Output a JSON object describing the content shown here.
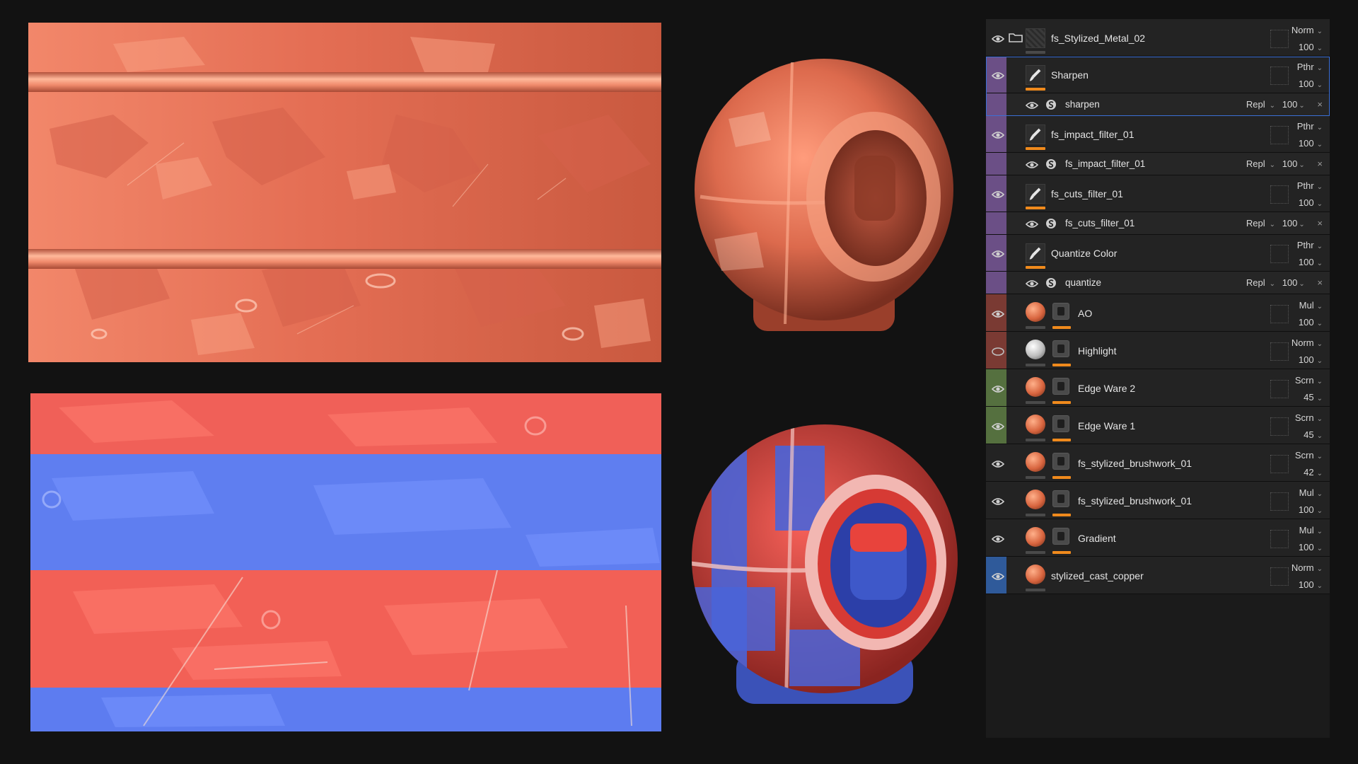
{
  "layers": [
    {
      "name": "fs_Stylized_Metal_02",
      "blend": "Norm",
      "opacity": "100",
      "type": "folder",
      "strip": "",
      "thumb": "folder"
    },
    {
      "name": "Sharpen",
      "blend": "Pthr",
      "opacity": "100",
      "type": "filter",
      "strip": "#6b4f86",
      "sub": {
        "name": "sharpen",
        "blend": "Repl",
        "opacity": "100"
      }
    },
    {
      "name": "fs_impact_filter_01",
      "blend": "Pthr",
      "opacity": "100",
      "type": "filter",
      "strip": "#6b4f86",
      "sub": {
        "name": "fs_impact_filter_01",
        "blend": "Repl",
        "opacity": "100"
      }
    },
    {
      "name": "fs_cuts_filter_01",
      "blend": "Pthr",
      "opacity": "100",
      "type": "filter",
      "strip": "#6b4f86",
      "sub": {
        "name": "fs_cuts_filter_01",
        "blend": "Repl",
        "opacity": "100"
      }
    },
    {
      "name": "Quantize Color",
      "blend": "Pthr",
      "opacity": "100",
      "type": "filter",
      "strip": "#6b4f86",
      "sub": {
        "name": "quantize",
        "blend": "Repl",
        "opacity": "100"
      }
    },
    {
      "name": "AO",
      "blend": "Mul",
      "opacity": "100",
      "type": "fill",
      "strip": "#7a3a33",
      "sphere": "copper"
    },
    {
      "name": "Highlight",
      "blend": "Norm",
      "opacity": "100",
      "type": "fill",
      "strip": "#7a3a33",
      "sphere": "white",
      "eye": "hidden"
    },
    {
      "name": "Edge Ware 2",
      "blend": "Scrn",
      "opacity": "45",
      "type": "fill",
      "strip": "#55703f",
      "sphere": "copper"
    },
    {
      "name": "Edge Ware 1",
      "blend": "Scrn",
      "opacity": "45",
      "type": "fill",
      "strip": "#55703f",
      "sphere": "copper"
    },
    {
      "name": "fs_stylized_brushwork_01",
      "blend": "Scrn",
      "opacity": "42",
      "type": "fill",
      "strip": "",
      "sphere": "copper"
    },
    {
      "name": "fs_stylized_brushwork_01",
      "blend": "Mul",
      "opacity": "100",
      "type": "fill",
      "strip": "",
      "sphere": "copper"
    },
    {
      "name": "Gradient",
      "blend": "Mul",
      "opacity": "100",
      "type": "fill",
      "strip": "",
      "sphere": "copper"
    },
    {
      "name": "stylized_cast_copper",
      "blend": "Norm",
      "opacity": "100",
      "type": "base",
      "strip": "#2f5a9a",
      "sphere": "copper"
    }
  ],
  "colors": {
    "accent_orange": "#f08a1c",
    "selection_blue": "#3b6fd6",
    "copper": "#e0765a",
    "id_red": "#f25a52",
    "id_blue": "#5f7ef0"
  },
  "icons": {
    "visibility": "eye-icon",
    "folder": "folder-icon",
    "paint": "paintbrush-icon",
    "filter": "substance-filter-icon",
    "mask": "mask-icon",
    "close": "close-icon"
  }
}
